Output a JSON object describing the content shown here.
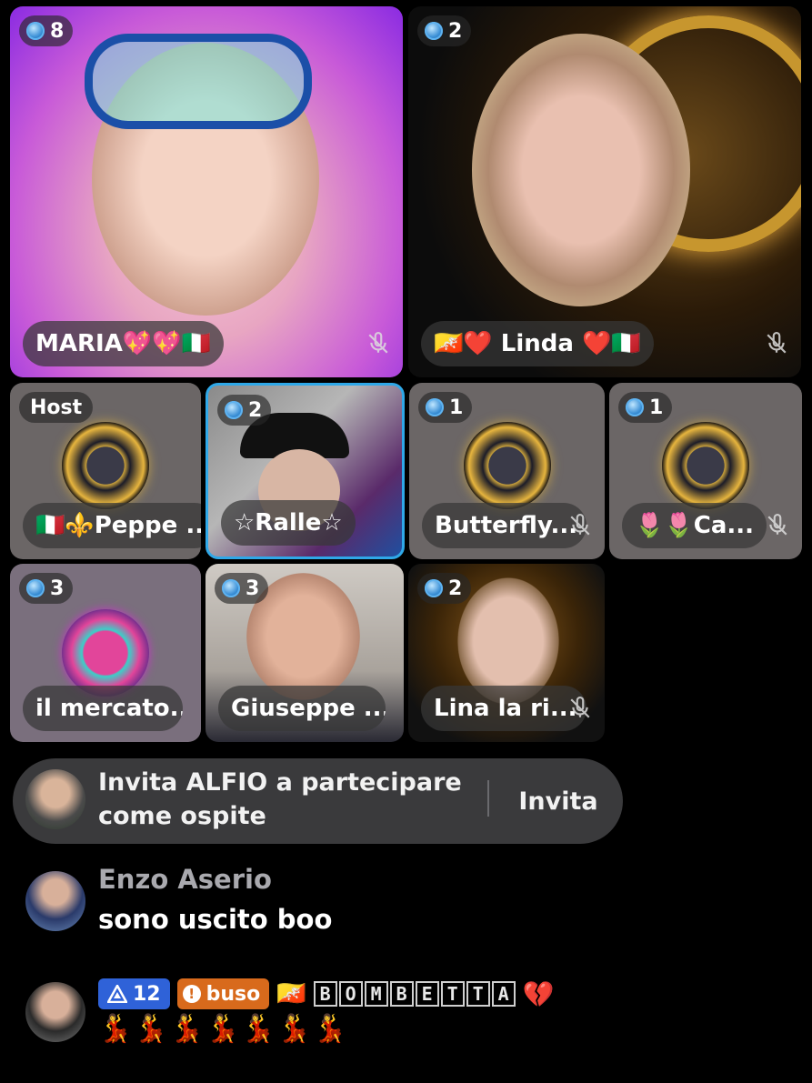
{
  "participants": [
    {
      "name": "MARIA💖💖🇮🇹",
      "count": "8",
      "muted": true
    },
    {
      "name": "🇧🇹❤️ Linda ❤️🇮🇹",
      "count": "2",
      "muted": true
    },
    {
      "name": "🇮🇹⚜️Peppe ...",
      "badge": "Host",
      "muted": false
    },
    {
      "name": "☆Ralle☆",
      "count": "2",
      "muted": false
    },
    {
      "name": "Butterfly...",
      "count": "1",
      "muted": true
    },
    {
      "name": "🌷🌷Ca...",
      "count": "1",
      "muted": true
    },
    {
      "name": "il mercato...",
      "count": "3",
      "muted": false
    },
    {
      "name": "Giuseppe ...",
      "count": "3",
      "muted": false
    },
    {
      "name": "Lina la ri...",
      "count": "2",
      "muted": true
    }
  ],
  "invite": {
    "text_line1": "Invita ALFIO a partecipare",
    "text_line2": "come ospite",
    "button": "Invita"
  },
  "comments": [
    {
      "user": "Enzo Aserio",
      "text": "sono uscito boo"
    },
    {
      "level": "12",
      "fan_badge": "buso",
      "name_flag": "🇧🇹",
      "user_letters": [
        "B",
        "O",
        "M",
        "B",
        "E",
        "T",
        "T",
        "A"
      ],
      "name_suffix": "💔",
      "text": "💃💃💃💃💃💃💃"
    }
  ],
  "colors": {
    "accent_selected": "#2fa8e8",
    "level_badge": "#2f62d8",
    "fan_badge": "#d86a1c"
  }
}
